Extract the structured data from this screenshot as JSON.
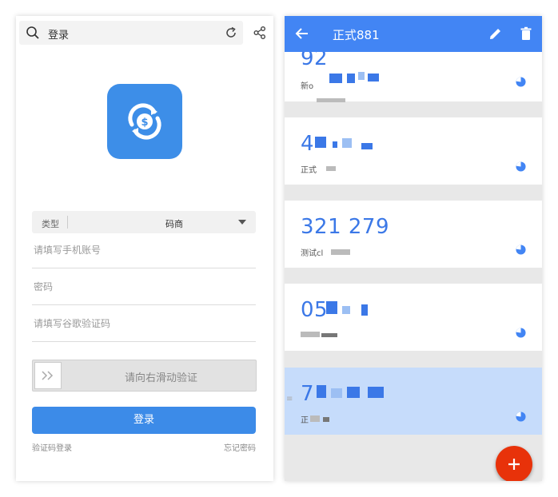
{
  "login": {
    "search_title": "登录",
    "type_label": "类型",
    "type_value": "码商",
    "phone_placeholder": "请填写手机账号",
    "password_placeholder": "密码",
    "google_code_placeholder": "请填写谷歌验证码",
    "slider_text": "请向右滑动验证",
    "login_button": "登录",
    "code_login_link": "验证码登录",
    "forgot_password_link": "忘记密码"
  },
  "authenticator": {
    "title": "正式881",
    "accent": "#4285f4",
    "fab_color": "#e8320a",
    "accounts": [
      {
        "code": "92",
        "name": "新o",
        "selected": false
      },
      {
        "code": "4",
        "name": "正式",
        "selected": false
      },
      {
        "code": "321 279",
        "name": "测试cl",
        "selected": false
      },
      {
        "code": "05",
        "name": "",
        "selected": false
      },
      {
        "code": "7",
        "name": "正",
        "selected": true
      }
    ]
  }
}
